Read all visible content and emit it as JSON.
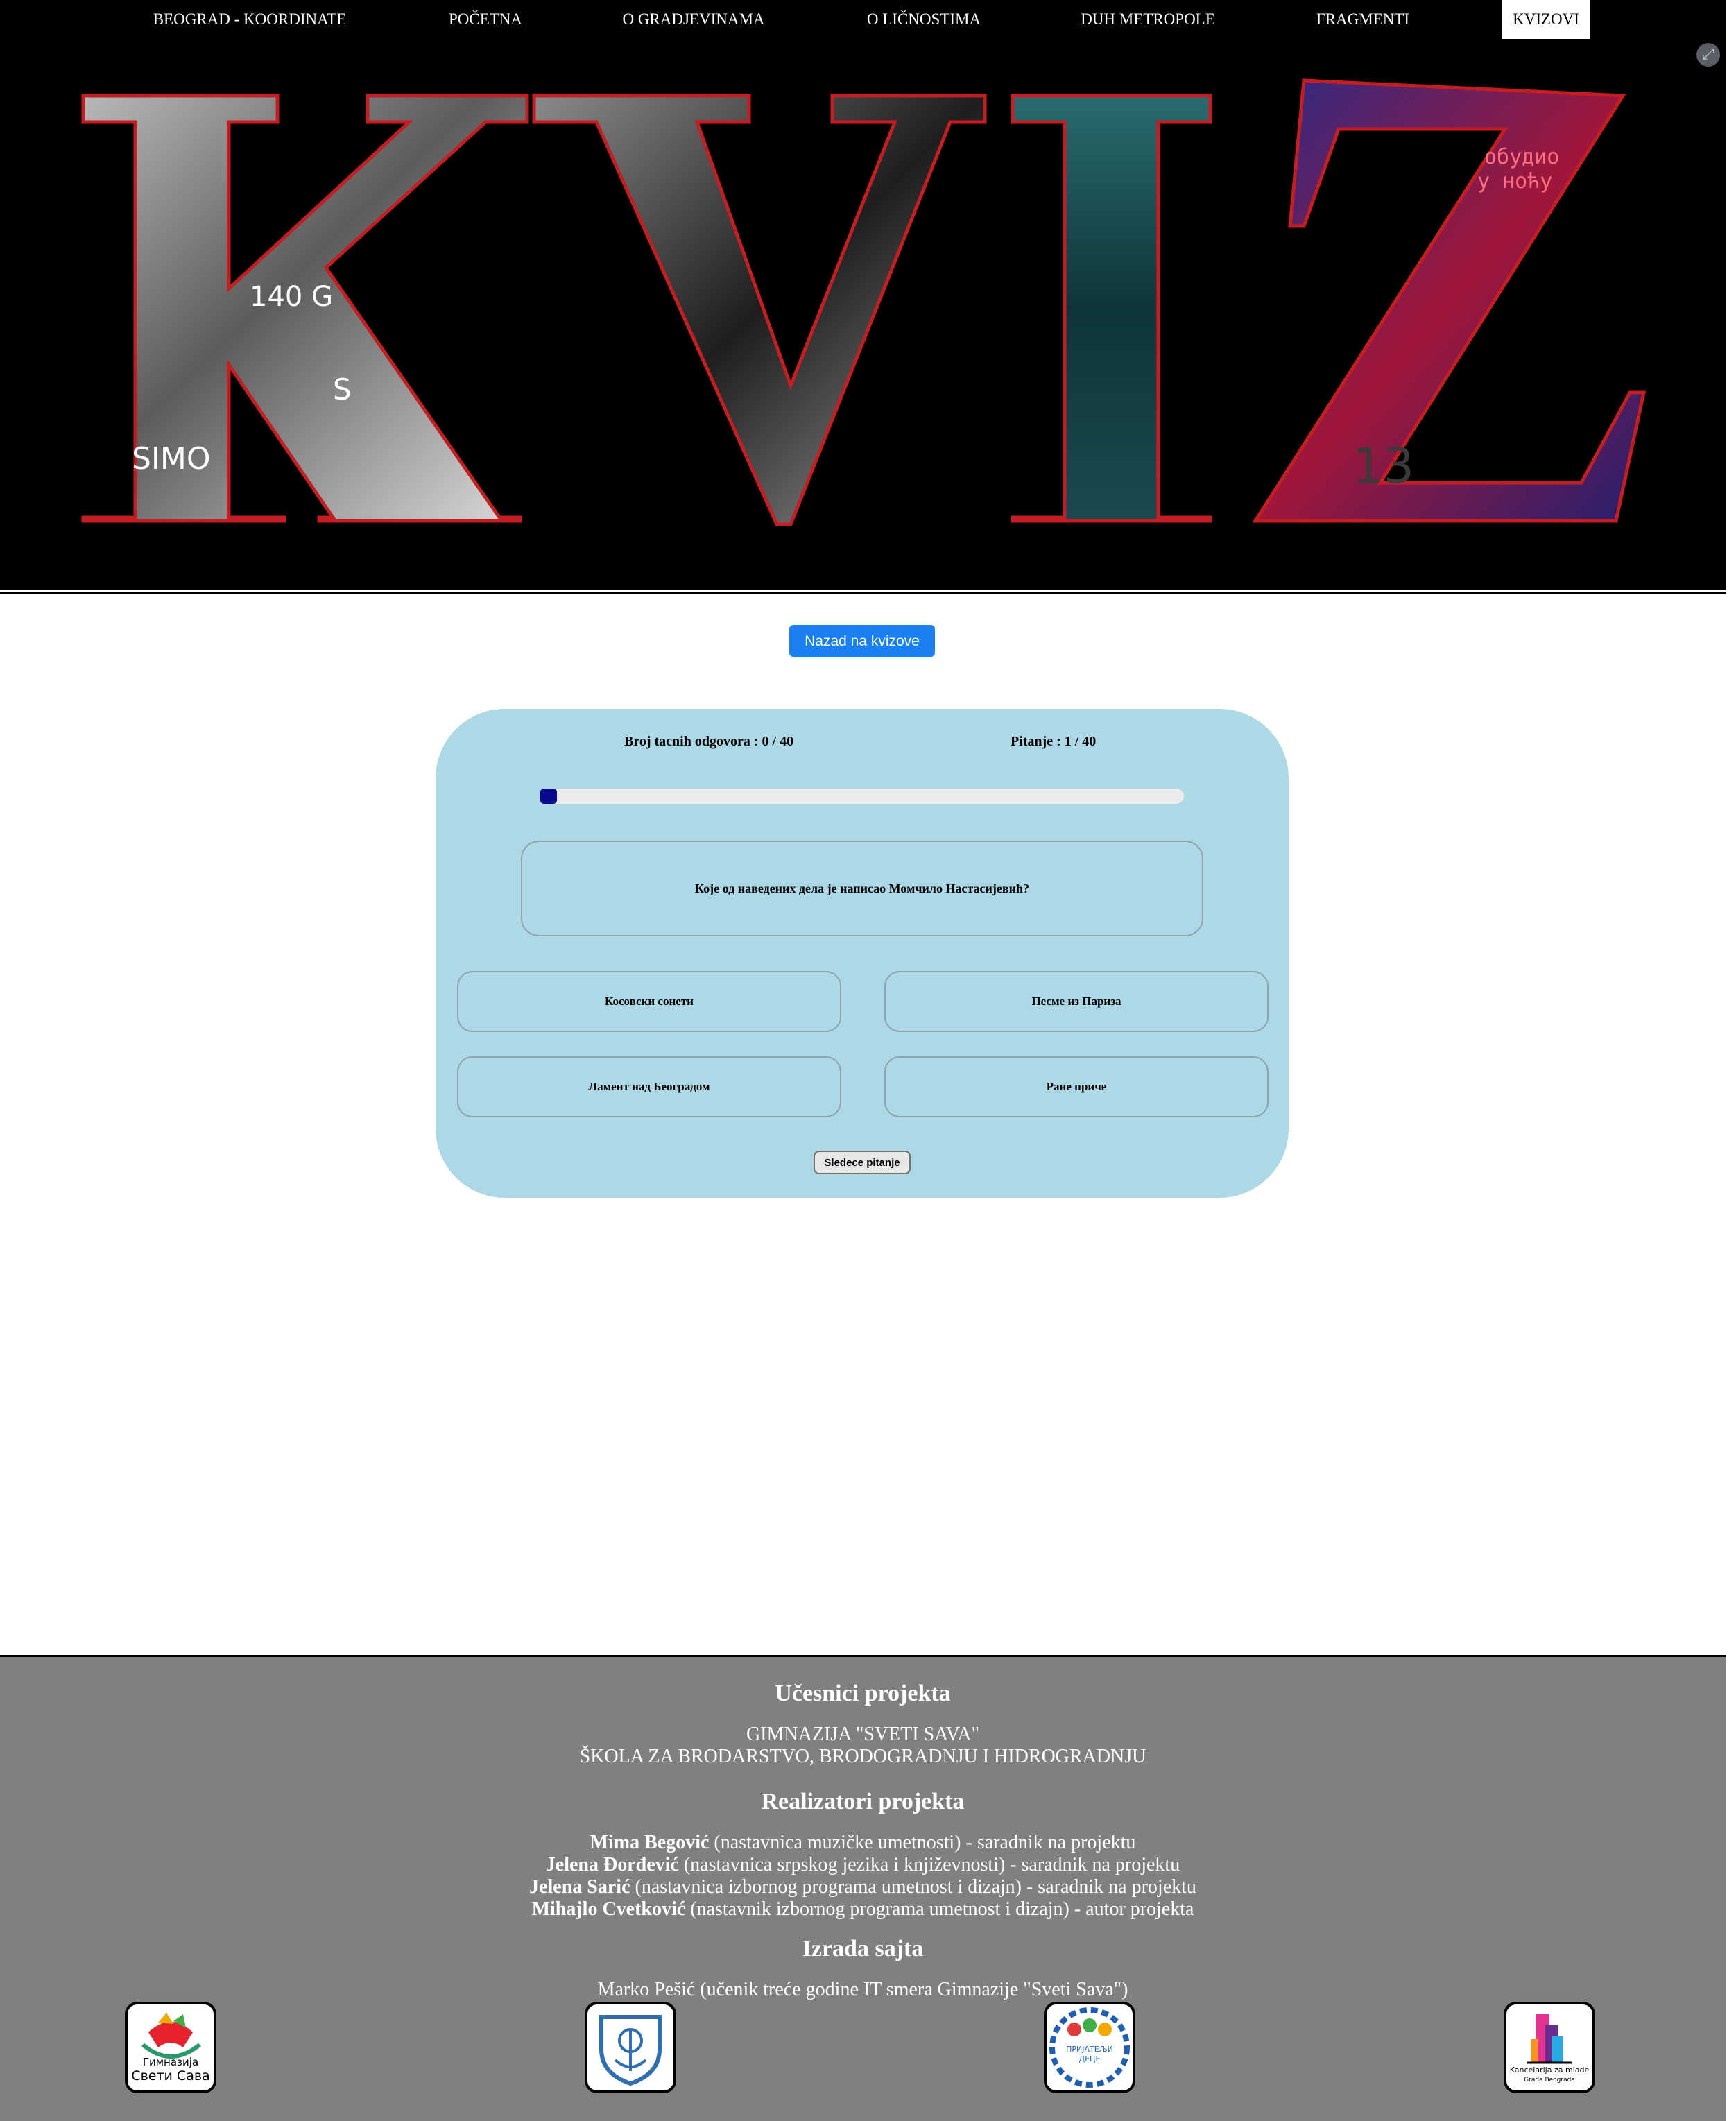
{
  "nav": {
    "items": [
      {
        "label": "BEOGRAD - KOORDINATE",
        "active": false
      },
      {
        "label": "POČETNA",
        "active": false
      },
      {
        "label": "O GRADJEVINAMA",
        "active": false
      },
      {
        "label": "O LIČNOSTIMA",
        "active": false
      },
      {
        "label": "DUH METROPOLE",
        "active": false
      },
      {
        "label": "FRAGMENTI",
        "active": false
      },
      {
        "label": "KVIZOVI",
        "active": true
      }
    ]
  },
  "hero": {
    "title": "KVIZ",
    "fragments": [
      "140 G",
      "SIMO",
      "S",
      "обудио",
      "у ноћу",
      "13"
    ],
    "accent_color": "#c41e22",
    "background_color": "#000000"
  },
  "back_button": {
    "label": "Nazad na kvizove",
    "color": "#1a7ff0"
  },
  "quiz": {
    "correct_label": "Broj tacnih odgovora : 0 / 40",
    "question_counter_label": "Pitanje : 1 / 40",
    "progress_fraction": 0.025,
    "question": "Које од наведених дела је написао Момчило Настасијевић?",
    "answers": [
      "Косовски сонети",
      "Песме из Париза",
      "Ламент над Београдом",
      "Ране приче"
    ],
    "next_label": "Sledece pitanje",
    "card_color": "#add8e6",
    "progress_color": "#0a0a8c"
  },
  "footer": {
    "participants_heading": "Učesnici projekta",
    "participants": [
      "GIMNAZIJA \"SVETI SAVA\"",
      "ŠKOLA ZA BRODARSTVO, BRODOGRADNJU I HIDROGRADNJU"
    ],
    "realizers_heading": "Realizatori projekta",
    "realizers": [
      {
        "name": "Mima Begović",
        "role": " (nastavnica muzičke umetnosti) - saradnik na projektu"
      },
      {
        "name": "Jelena Đorđević",
        "role": " (nastavnica srpskog jezika i književnosti) - saradnik na projektu"
      },
      {
        "name": "Jelena Sarić",
        "role": " (nastavnica izbornog programa umetnost i dizajn) - saradnik na projektu"
      },
      {
        "name": "Mihajlo Cvetković",
        "role": " (nastavnik izbornog programa umetnost i dizajn) - autor projekta"
      }
    ],
    "site_heading": "Izrada sajta",
    "site_author": "Marko Pešić (učenik treće godine IT smera Gimnazije \"Sveti Sava\")",
    "background_color": "#808080",
    "logos": [
      {
        "icon": "gimnazija-sveti-sava-logo",
        "text_line1": "Гимназија",
        "text_line2": "Свети Сава"
      },
      {
        "icon": "brodarska-skola-logo"
      },
      {
        "icon": "prijatelji-dece-logo",
        "text_line1": "ПРИЈАТЕЉИ",
        "text_line2": "ДЕЦЕ"
      },
      {
        "icon": "kancelarija-za-mlade-logo",
        "text_line1": "Kancelarija za mlade",
        "text_line2": "Grada Beograda"
      }
    ]
  }
}
